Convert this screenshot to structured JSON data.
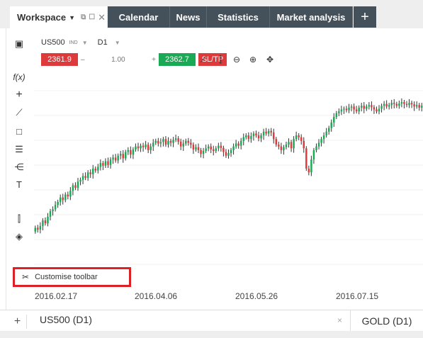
{
  "topbar": {
    "workspace_label": "Workspace",
    "tabs": [
      {
        "label": "Calendar"
      },
      {
        "label": "News"
      },
      {
        "label": "Statistics"
      },
      {
        "label": "Market analysis"
      }
    ],
    "add_tab_label": "+"
  },
  "instrument": {
    "symbol": "US500",
    "type": "IND",
    "interval": "D1"
  },
  "trade": {
    "sell_price": "2361.9",
    "minus": "–",
    "volume": "1.00",
    "plus": "+",
    "buy_price": "2362.7",
    "sltp_label": "SL/TP"
  },
  "left_tools": [
    "chart-type-icon",
    "indicator-icon",
    "crosshair-icon",
    "trendline-icon",
    "rectangle-icon",
    "fibonacci-icon",
    "pitchfork-icon",
    "text-icon",
    "candle-settings-icon",
    "layers-icon"
  ],
  "chart_tools": [
    "line-chart-icon",
    "candle-chart-icon",
    "zoom-out-icon",
    "zoom-in-icon",
    "move-icon"
  ],
  "customise": {
    "label": "Customise toolbar"
  },
  "chart_data": {
    "type": "candlestick",
    "x_tick_labels": [
      "2016.02.17",
      "2016.04.06",
      "2016.05.26",
      "2016.07.15"
    ],
    "colors": {
      "up": "#1aaa55",
      "down": "#dd3b3b"
    },
    "grid": true,
    "closes": [
      1850,
      1845,
      1855,
      1870,
      1862,
      1880,
      1895,
      1900,
      1912,
      1920,
      1932,
      1925,
      1940,
      1935,
      1950,
      1965,
      1958,
      1975,
      1980,
      1990,
      1985,
      2000,
      1995,
      2010,
      2005,
      2015,
      2025,
      2018,
      2030,
      2020,
      2035,
      2040,
      2032,
      2045,
      2050,
      2038,
      2055,
      2060,
      2048,
      2062,
      2070,
      2065,
      2072,
      2068,
      2075,
      2060,
      2070,
      2080,
      2085,
      2078,
      2082,
      2090,
      2075,
      2085,
      2080,
      2088,
      2092,
      2083,
      2070,
      2078,
      2085,
      2080,
      2075,
      2062,
      2068,
      2060,
      2050,
      2058,
      2065,
      2070,
      2062,
      2058,
      2065,
      2072,
      2066,
      2055,
      2045,
      2052,
      2060,
      2070,
      2078,
      2072,
      2085,
      2095,
      2100,
      2090,
      2098,
      2105,
      2100,
      2092,
      2100,
      2110,
      2105,
      2112,
      2108,
      2090,
      2075,
      2070,
      2060,
      2068,
      2075,
      2082,
      2065,
      2090,
      2100,
      2095,
      2085,
      2065,
      2010,
      2000,
      2035,
      2060,
      2070,
      2080,
      2090,
      2100,
      2110,
      2120,
      2135,
      2150,
      2160,
      2165,
      2170,
      2172,
      2168,
      2175,
      2178,
      2170,
      2165,
      2175,
      2180,
      2172,
      2178,
      2182,
      2176,
      2170,
      2165,
      2172,
      2180,
      2185,
      2178,
      2182,
      2188,
      2185,
      2180,
      2186,
      2190,
      2185,
      2182,
      2188,
      2184,
      2178,
      2182,
      2175,
      2180
    ]
  },
  "bottom": {
    "add_label": "+",
    "active_tab": "US500 (D1)",
    "close": "×",
    "other_tab": "GOLD (D1)"
  }
}
